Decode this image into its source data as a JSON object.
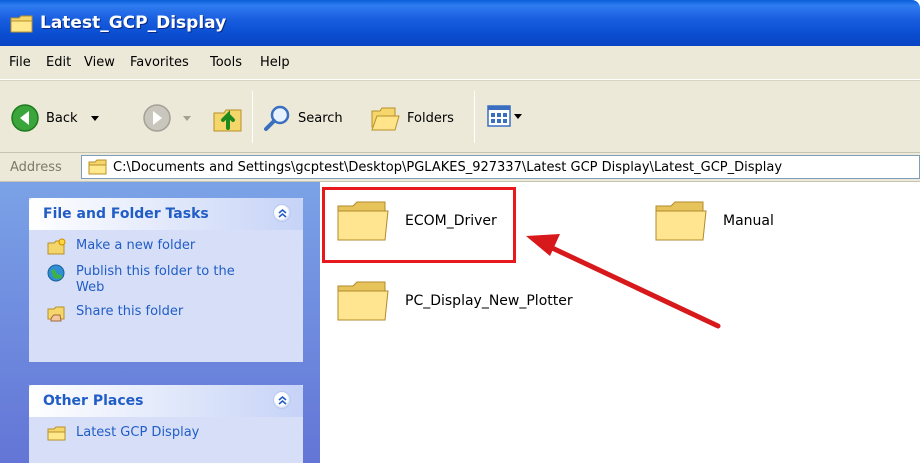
{
  "window": {
    "title": "Latest_GCP_Display"
  },
  "menu": [
    "File",
    "Edit",
    "View",
    "Favorites",
    "Tools",
    "Help"
  ],
  "toolbar": {
    "back_label": "Back",
    "search_label": "Search",
    "folders_label": "Folders"
  },
  "address": {
    "label": "Address",
    "path": "C:\\Documents and Settings\\gcptest\\Desktop\\PGLAKES_927337\\Latest GCP Display\\Latest_GCP_Display"
  },
  "left_pane": {
    "tasks": {
      "title": "File and Folder Tasks",
      "items": [
        {
          "label": "Make a new folder",
          "icon": "new-folder-icon"
        },
        {
          "label": "Publish this folder to the Web",
          "icon": "publish-web-icon"
        },
        {
          "label": "Share this folder",
          "icon": "share-folder-icon"
        }
      ]
    },
    "other_places": {
      "title": "Other Places",
      "items": [
        {
          "label": "Latest GCP Display",
          "icon": "folder-icon"
        }
      ]
    }
  },
  "folders": [
    {
      "name": "ECOM_Driver"
    },
    {
      "name": "Manual"
    },
    {
      "name": "PC_Display_New_Plotter"
    }
  ],
  "colors": {
    "titlebar": "#0b4fd3",
    "task_link": "#215dc6",
    "annotation": "#e8191d"
  }
}
